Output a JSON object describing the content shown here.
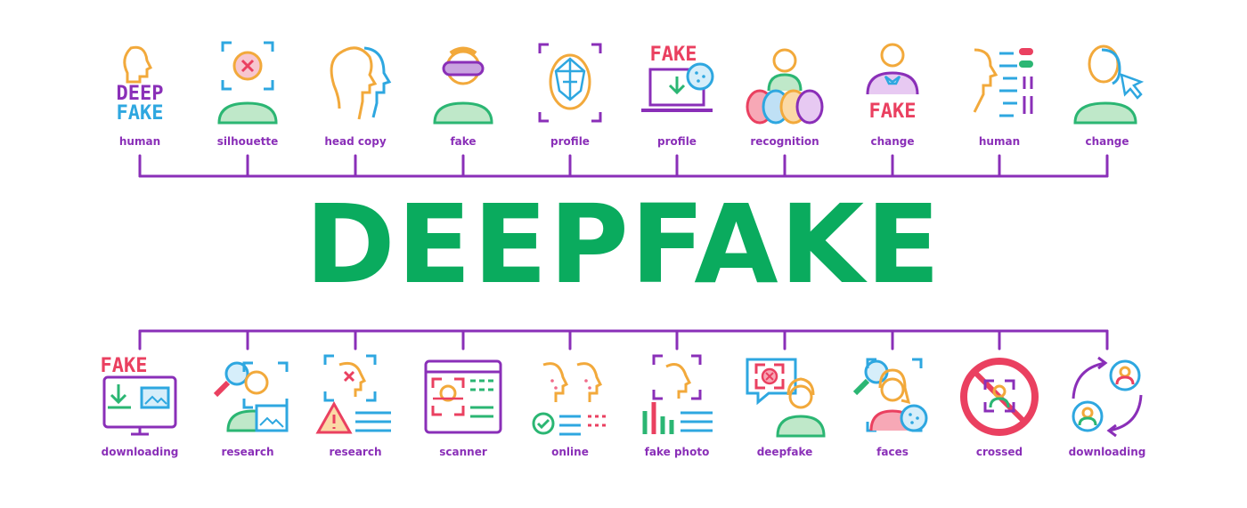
{
  "title": "DEEPFAKE",
  "colors": {
    "title": "#0aab5e",
    "connector": "#8a2fb8",
    "label": "#8a2fb8",
    "icon_palette": [
      "#f2a93b",
      "#2ea7e0",
      "#8a2fb8",
      "#2bb673",
      "#ea4060",
      "#f06b8a"
    ]
  },
  "top_items": [
    {
      "label": "human",
      "icon": "human-deep-fake-icon",
      "text": "DEEP FAKE"
    },
    {
      "label": "silhouette",
      "icon": "silhouette-cross-icon"
    },
    {
      "label": "head copy",
      "icon": "head-copy-icon"
    },
    {
      "label": "fake",
      "icon": "fake-vr-mask-icon"
    },
    {
      "label": "profile",
      "icon": "face-scan-profile-icon"
    },
    {
      "label": "profile",
      "icon": "laptop-fake-download-icon",
      "text": "FAKE"
    },
    {
      "label": "recognition",
      "icon": "recognition-faces-icon"
    },
    {
      "label": "change",
      "icon": "change-fake-suit-icon",
      "text": "FAKE"
    },
    {
      "label": "human",
      "icon": "human-settings-icon"
    },
    {
      "label": "change",
      "icon": "change-mask-cursor-icon"
    }
  ],
  "bottom_items": [
    {
      "label": "downloading",
      "icon": "monitor-fake-download-icon",
      "text": "FAKE"
    },
    {
      "label": "research",
      "icon": "research-magnifier-icon"
    },
    {
      "label": "research",
      "icon": "research-warning-icon"
    },
    {
      "label": "scanner",
      "icon": "browser-scanner-icon"
    },
    {
      "label": "online",
      "icon": "online-heads-icon"
    },
    {
      "label": "fake photo",
      "icon": "fake-photo-chart-icon"
    },
    {
      "label": "deepfake",
      "icon": "deepfake-chat-icon"
    },
    {
      "label": "faces",
      "icon": "faces-woman-search-icon"
    },
    {
      "label": "crossed",
      "icon": "crossed-prohibited-icon"
    },
    {
      "label": "downloading",
      "icon": "swap-users-icon"
    }
  ]
}
